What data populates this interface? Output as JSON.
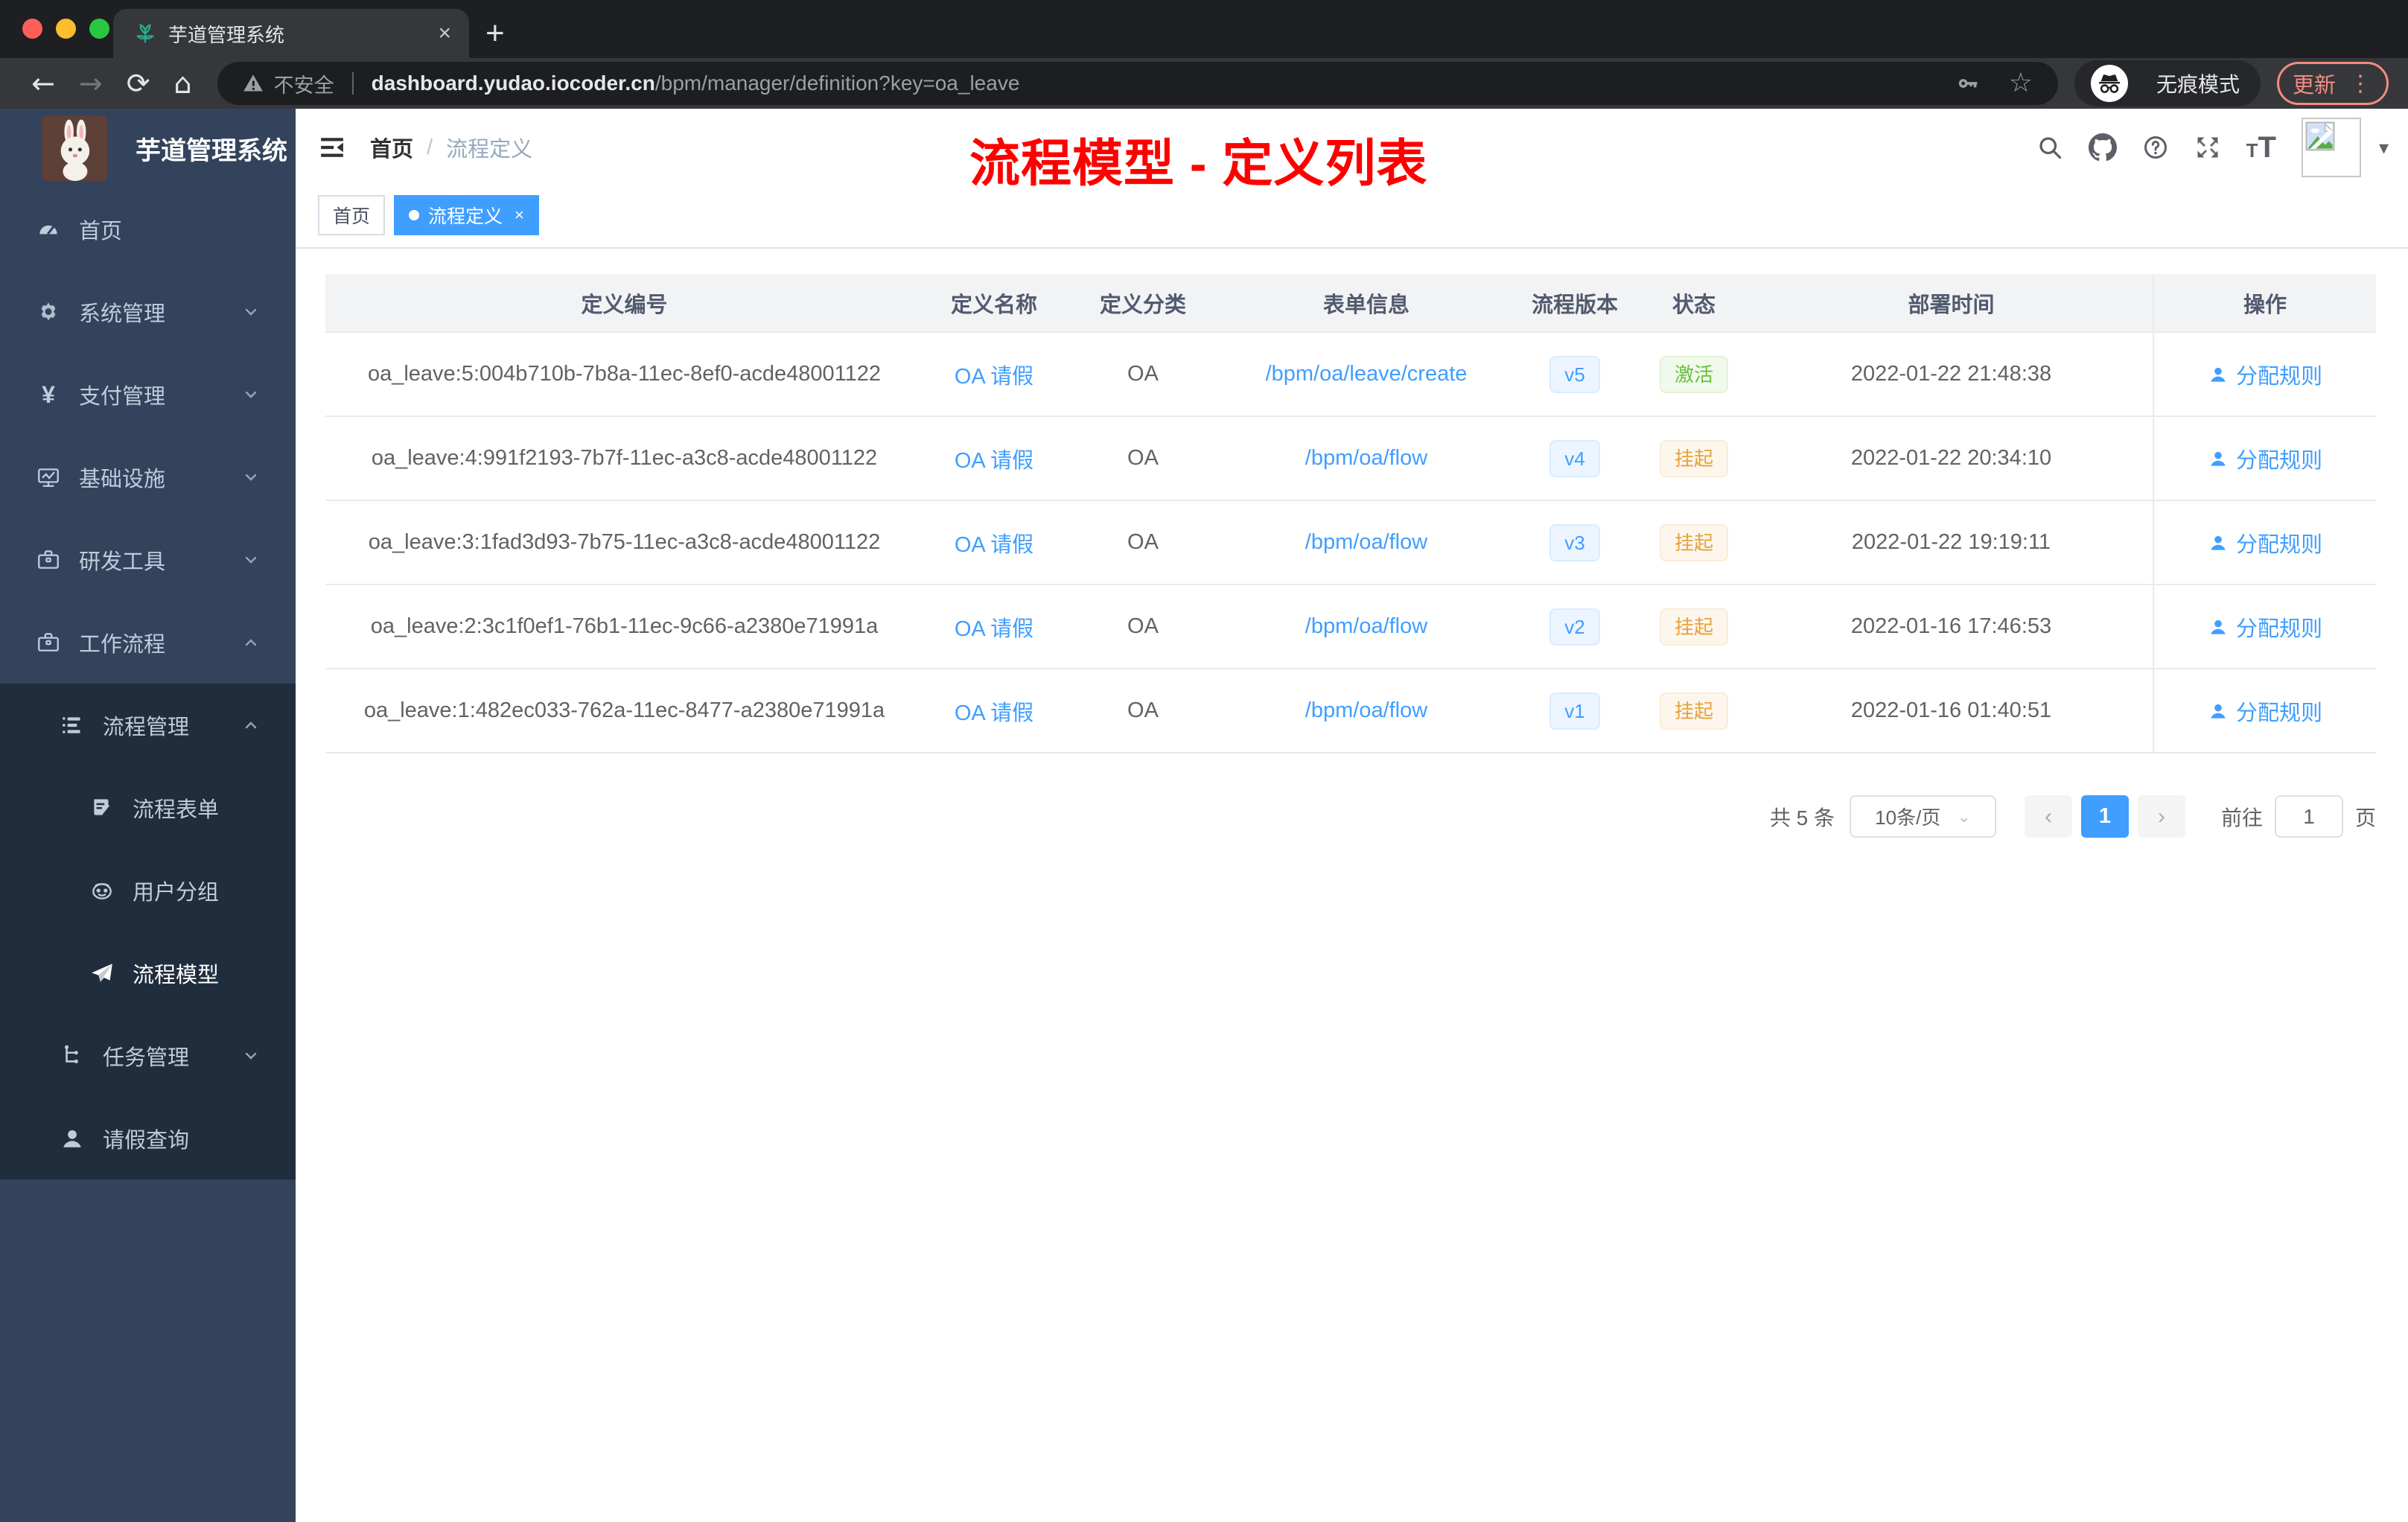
{
  "browser": {
    "tab_title": "芋道管理系统",
    "address": {
      "security_label": "不安全",
      "host": "dashboard.yudao.iocoder.cn",
      "path": "/bpm/manager/definition?key=oa_leave"
    },
    "incognito_label": "无痕模式",
    "update_label": "更新"
  },
  "glyphs": {
    "back": "←",
    "forward": "→",
    "reload": "⟳",
    "home": "⌂",
    "plus": "+",
    "tab_close": "×",
    "menu_dots": "⋮",
    "star": "☆",
    "caret_down": "▾",
    "select_caret": "⌄",
    "prev": "‹",
    "next": "›",
    "tag_close": "×",
    "breadcrumb_sep": "/",
    "yen": "¥",
    "t_small": "T",
    "t_large": "T"
  },
  "sidebar": {
    "app_title": "芋道管理系统",
    "items": [
      {
        "label": "首页"
      },
      {
        "label": "系统管理"
      },
      {
        "label": "支付管理"
      },
      {
        "label": "基础设施"
      },
      {
        "label": "研发工具"
      },
      {
        "label": "工作流程"
      },
      {
        "label": "流程管理"
      },
      {
        "label": "流程表单"
      },
      {
        "label": "用户分组"
      },
      {
        "label": "流程模型"
      },
      {
        "label": "任务管理"
      },
      {
        "label": "请假查询"
      }
    ]
  },
  "header": {
    "breadcrumb_home": "首页",
    "breadcrumb_current": "流程定义",
    "annotation": "流程模型 - 定义列表"
  },
  "tags": {
    "home": "首页",
    "active": "流程定义"
  },
  "table": {
    "columns": [
      "定义编号",
      "定义名称",
      "定义分类",
      "表单信息",
      "流程版本",
      "状态",
      "部署时间",
      "操作"
    ],
    "rows": [
      {
        "id": "oa_leave:5:004b710b-7b8a-11ec-8ef0-acde48001122",
        "name": "OA 请假",
        "category": "OA",
        "form": "/bpm/oa/leave/create",
        "version": "v5",
        "status": "激活",
        "time": "2022-01-22 21:48:38",
        "action": "分配规则"
      },
      {
        "id": "oa_leave:4:991f2193-7b7f-11ec-a3c8-acde48001122",
        "name": "OA 请假",
        "category": "OA",
        "form": "/bpm/oa/flow",
        "version": "v4",
        "status": "挂起",
        "time": "2022-01-22 20:34:10",
        "action": "分配规则"
      },
      {
        "id": "oa_leave:3:1fad3d93-7b75-11ec-a3c8-acde48001122",
        "name": "OA 请假",
        "category": "OA",
        "form": "/bpm/oa/flow",
        "version": "v3",
        "status": "挂起",
        "time": "2022-01-22 19:19:11",
        "action": "分配规则"
      },
      {
        "id": "oa_leave:2:3c1f0ef1-76b1-11ec-9c66-a2380e71991a",
        "name": "OA 请假",
        "category": "OA",
        "form": "/bpm/oa/flow",
        "version": "v2",
        "status": "挂起",
        "time": "2022-01-16 17:46:53",
        "action": "分配规则"
      },
      {
        "id": "oa_leave:1:482ec033-762a-11ec-8477-a2380e71991a",
        "name": "OA 请假",
        "category": "OA",
        "form": "/bpm/oa/flow",
        "version": "v1",
        "status": "挂起",
        "time": "2022-01-16 01:40:51",
        "action": "分配规则"
      }
    ]
  },
  "pagination": {
    "total": "共 5 条",
    "page_size": "10条/页",
    "current_page": "1",
    "goto_label": "前往",
    "goto_value": "1",
    "page_unit": "页"
  }
}
